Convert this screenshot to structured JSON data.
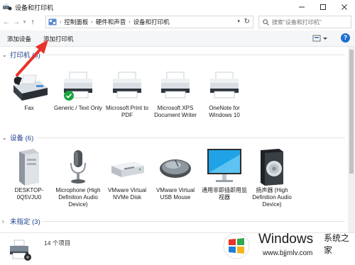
{
  "window": {
    "title": "设备和打印机",
    "controls": [
      "minimize",
      "maximize",
      "close"
    ]
  },
  "nav": {
    "breadcrumbs": [
      "控制面板",
      "硬件和声音",
      "设备和打印机"
    ],
    "search_placeholder": "搜索\"设备和打印机\""
  },
  "toolbar": {
    "add_device": "添加设备",
    "add_printer": "添加打印机"
  },
  "sections": {
    "printers": {
      "label": "打印机 (5)",
      "items": [
        {
          "caption": "Fax",
          "icon": "fax-icon"
        },
        {
          "caption": "Generic / Text Only",
          "icon": "printer-icon",
          "default": true
        },
        {
          "caption": "Microsoft Print to PDF",
          "icon": "printer-icon"
        },
        {
          "caption": "Microsoft XPS Document Writer",
          "icon": "printer-icon"
        },
        {
          "caption": "OneNote for Windows 10",
          "icon": "printer-icon"
        }
      ]
    },
    "devices": {
      "label": "设备 (6)",
      "items": [
        {
          "caption": "DESKTOP-0Q5VJU0",
          "icon": "computer-tower-icon"
        },
        {
          "caption": "Microphone (High Definition Audio Device)",
          "icon": "microphone-icon"
        },
        {
          "caption": "VMware Virtual NVMe Disk",
          "icon": "hard-disk-icon"
        },
        {
          "caption": "VMware Virtual USB Mouse",
          "icon": "mouse-icon"
        },
        {
          "caption": "通用非即插即用监视器",
          "icon": "monitor-icon"
        },
        {
          "caption": "扬声器 (High Definition Audio Device)",
          "icon": "speaker-icon"
        }
      ]
    },
    "unspecified": {
      "label": "未指定 (3)"
    }
  },
  "details": {
    "count": "14 个项目"
  },
  "watermark": {
    "brand": "Windows",
    "cn": "系统之家",
    "url": "www.bjjmlv.com"
  },
  "colors": {
    "accent": "#1e3f8f",
    "annotation": "#e8322a",
    "check": "#18a53f",
    "help": "#1e6fd0"
  }
}
